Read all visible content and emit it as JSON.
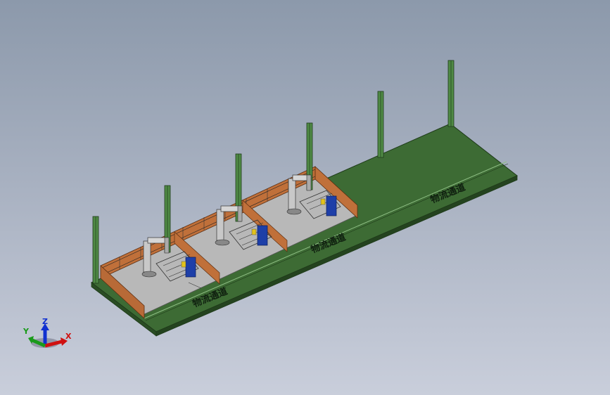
{
  "viewport": {
    "background_top": "#8c99ab",
    "background_bottom": "#c9cedb"
  },
  "colors": {
    "floor_green": "#3d6b34",
    "floor_edge": "#26461f",
    "cell_floor": "#b9b9b9",
    "fence_orange": "#c0703a",
    "column_green": "#4f8a45",
    "robot_blue": "#1e3fa8",
    "robot_gray": "#c8c8c8"
  },
  "scene": {
    "channel_labels": [
      "物流通道",
      "物流通道",
      "物流通道"
    ],
    "cells": [
      "cell-1",
      "cell-2",
      "cell-3"
    ],
    "columns_count": 6
  },
  "triad": {
    "x_label": "X",
    "y_label": "Y",
    "z_label": "Z",
    "x_color": "#d01010",
    "y_color": "#1a9a1a",
    "z_color": "#1030d0"
  }
}
